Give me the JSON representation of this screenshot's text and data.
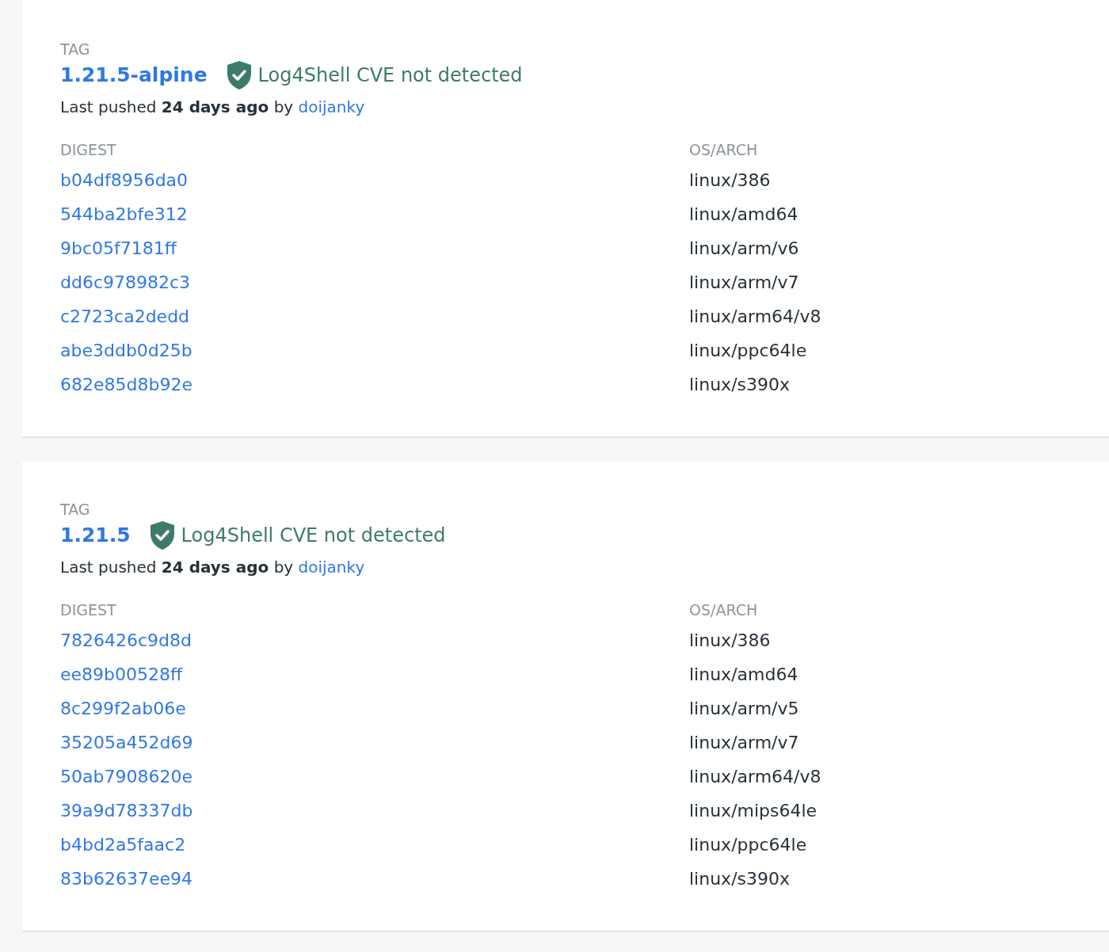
{
  "tags": [
    {
      "heading": "TAG",
      "name": "1.21.5-alpine",
      "scan": {
        "detected": false,
        "label": "Log4Shell CVE not detected"
      },
      "pushed_text": "Last pushed **24 days ago** by",
      "pushed_by": "doijanky",
      "columns": [
        "DIGEST",
        "OS/ARCH"
      ],
      "rows": [
        {
          "digest": "b04df8956da0",
          "os_arch": "linux/386"
        },
        {
          "digest": "544ba2bfe312",
          "os_arch": "linux/amd64"
        },
        {
          "digest": "9bc05f7181ff",
          "os_arch": "linux/arm/v6"
        },
        {
          "digest": "dd6c978982c3",
          "os_arch": "linux/arm/v7"
        },
        {
          "digest": "c2723ca2dedd",
          "os_arch": "linux/arm64/v8"
        },
        {
          "digest": "abe3ddb0d25b",
          "os_arch": "linux/ppc64le"
        },
        {
          "digest": "682e85d8b92e",
          "os_arch": "linux/s390x"
        }
      ]
    },
    {
      "heading": "TAG",
      "name": "1.21.5",
      "scan": {
        "detected": false,
        "label": "Log4Shell CVE not detected"
      },
      "pushed_text": "Last pushed **24 days ago** by",
      "pushed_by": "doijanky",
      "columns": [
        "DIGEST",
        "OS/ARCH"
      ],
      "rows": [
        {
          "digest": "7826426c9d8d",
          "os_arch": "linux/386"
        },
        {
          "digest": "ee89b00528ff",
          "os_arch": "linux/amd64"
        },
        {
          "digest": "8c299f2ab06e",
          "os_arch": "linux/arm/v5"
        },
        {
          "digest": "35205a452d69",
          "os_arch": "linux/arm/v7"
        },
        {
          "digest": "50ab7908620e",
          "os_arch": "linux/arm64/v8"
        },
        {
          "digest": "39a9d78337db",
          "os_arch": "linux/mips64le"
        },
        {
          "digest": "b4bd2a5faac2",
          "os_arch": "linux/ppc64le"
        },
        {
          "digest": "83b62637ee94",
          "os_arch": "linux/s390x"
        }
      ]
    }
  ]
}
